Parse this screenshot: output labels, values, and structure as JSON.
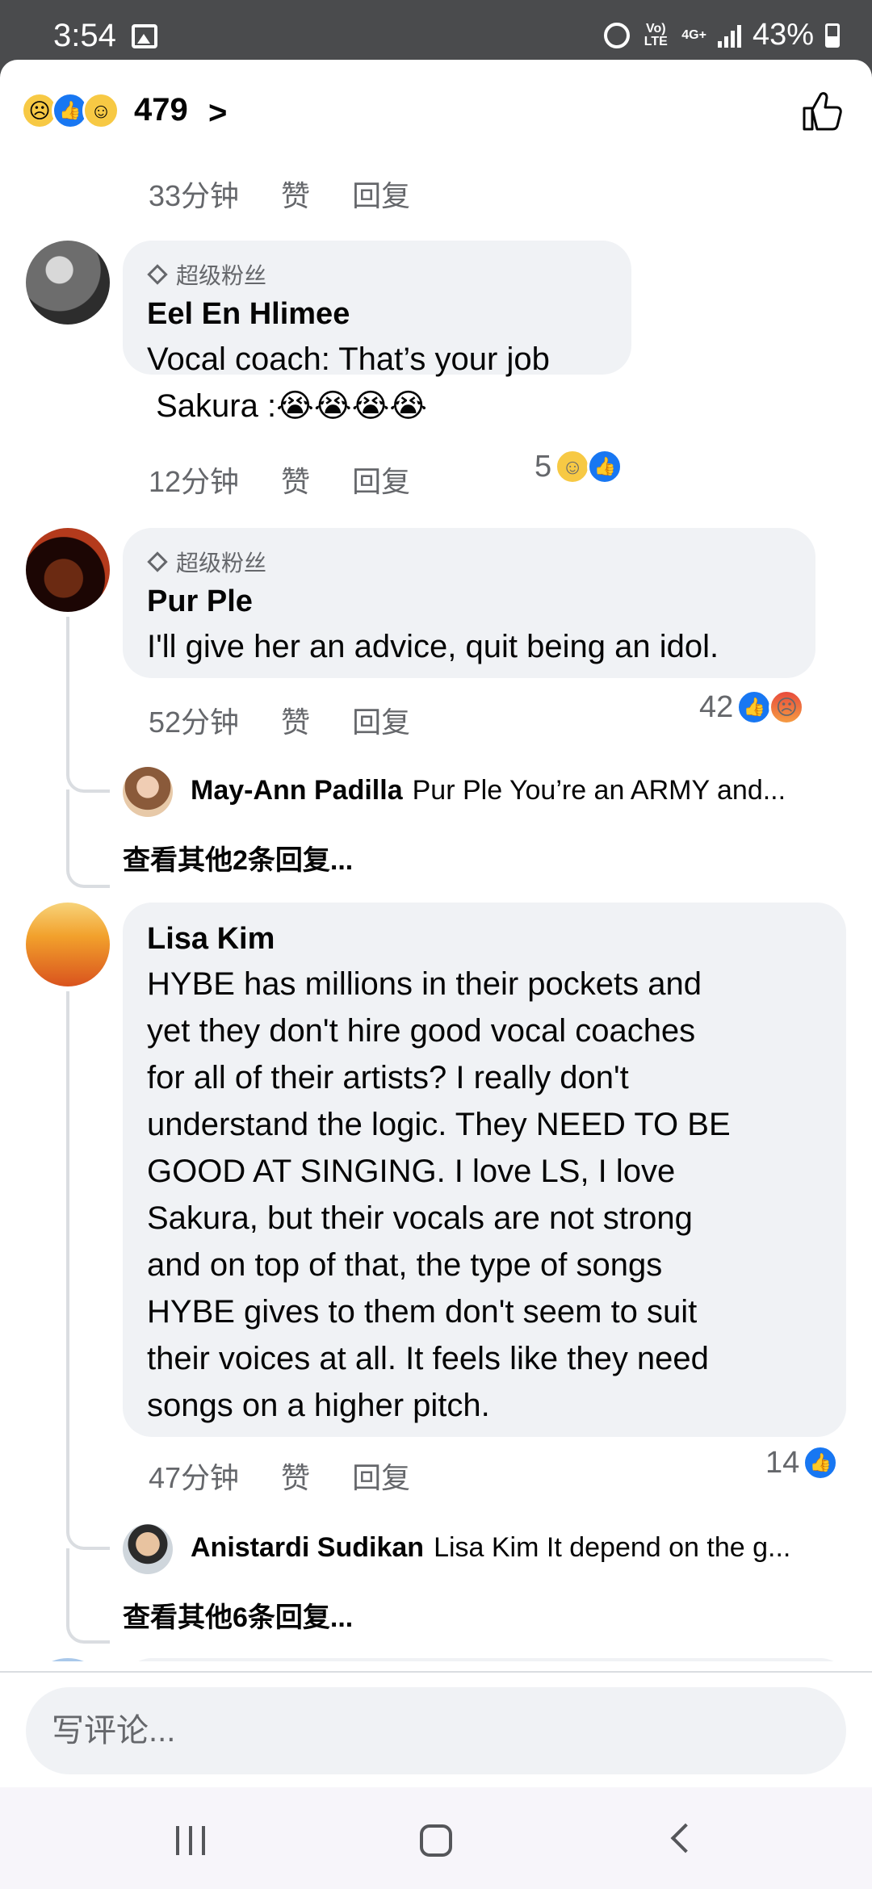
{
  "status": {
    "time": "3:54",
    "network_label": "Vo) LTE",
    "net_type": "4G+",
    "battery": "43%"
  },
  "header": {
    "reaction_count": "479",
    "reactions": [
      "sad",
      "like",
      "haha"
    ]
  },
  "top_meta": {
    "time": "33分钟",
    "like": "赞",
    "reply": "回复"
  },
  "comments": [
    {
      "badge": "超级粉丝",
      "author": "Eel En Hlimee",
      "text": "Vocal coach: That’s your job\n Sakura :😭😭😭😭",
      "time": "12分钟",
      "like": "赞",
      "reply": "回复",
      "reaction_count": "5",
      "reactions": [
        "haha",
        "like"
      ]
    },
    {
      "badge": "超级粉丝",
      "author": "Pur Ple",
      "text": "I'll give her an advice, quit being an idol.",
      "time": "52分钟",
      "like": "赞",
      "reply": "回复",
      "reaction_count": "42",
      "reactions": [
        "like",
        "angry"
      ],
      "reply_preview": {
        "name": "May-Ann Padilla",
        "text": "Pur Ple You’re an ARMY and..."
      },
      "more_replies": "查看其他2条回复..."
    },
    {
      "author": "Lisa Kim",
      "text": "HYBE has millions in their pockets and\nyet they don't hire good vocal coaches\nfor all of their artists? I really don't\nunderstand the logic. They NEED TO BE\nGOOD AT SINGING. I love LS, I love\nSakura, but their vocals are not strong\nand on top of that, the type of songs\nHYBE gives to them don't seem to suit\ntheir voices at all. It feels like they need\nsongs on a higher pitch.",
      "time": "47分钟",
      "like": "赞",
      "reply": "回复",
      "reaction_count": "14",
      "reactions": [
        "like"
      ],
      "reply_preview": {
        "name": "Anistardi Sudikan",
        "text": "Lisa Kim It depend on the g..."
      },
      "more_replies": "查看其他6条回复..."
    }
  ],
  "composer": {
    "placeholder": "写评论..."
  },
  "colors": {
    "like_blue": "#1877f2",
    "bubble": "#f0f2f5",
    "muted": "#65676b"
  }
}
